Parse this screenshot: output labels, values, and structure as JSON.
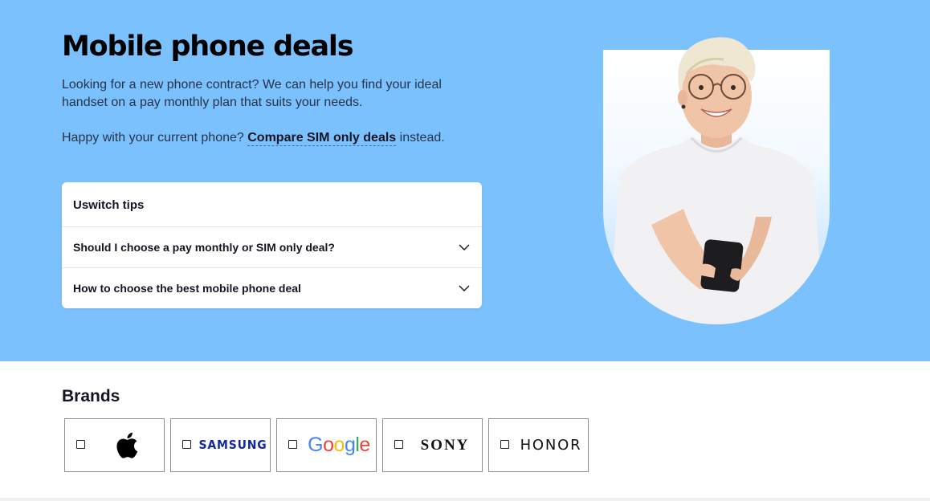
{
  "hero": {
    "title": "Mobile phone deals",
    "intro": "Looking for a new phone contract? We can help you find your ideal handset on a pay monthly plan that suits your needs.",
    "sim_prefix": "Happy with your current phone?",
    "sim_link": "Compare SIM only deals",
    "sim_suffix": "instead.",
    "background_color": "#7bc1fe"
  },
  "tips": {
    "heading": "Uswitch tips",
    "items": [
      {
        "label": "Should I choose a pay monthly or SIM only deal?",
        "icon": "chevron-down-icon"
      },
      {
        "label": "How to choose the best mobile phone deal",
        "icon": "chevron-down-icon"
      }
    ]
  },
  "hero_image": {
    "alt": "Woman smiling holding a phone"
  },
  "brands": {
    "heading": "Brands",
    "items": [
      {
        "name": "Apple",
        "logo": "apple-logo",
        "checked": false
      },
      {
        "name": "SAMSUNG",
        "logo": "samsung-logo",
        "checked": false
      },
      {
        "name": "Google",
        "logo": "google-logo",
        "checked": false
      },
      {
        "name": "SONY",
        "logo": "sony-logo",
        "checked": false
      },
      {
        "name": "HONOR",
        "logo": "honor-logo",
        "checked": false
      }
    ]
  }
}
